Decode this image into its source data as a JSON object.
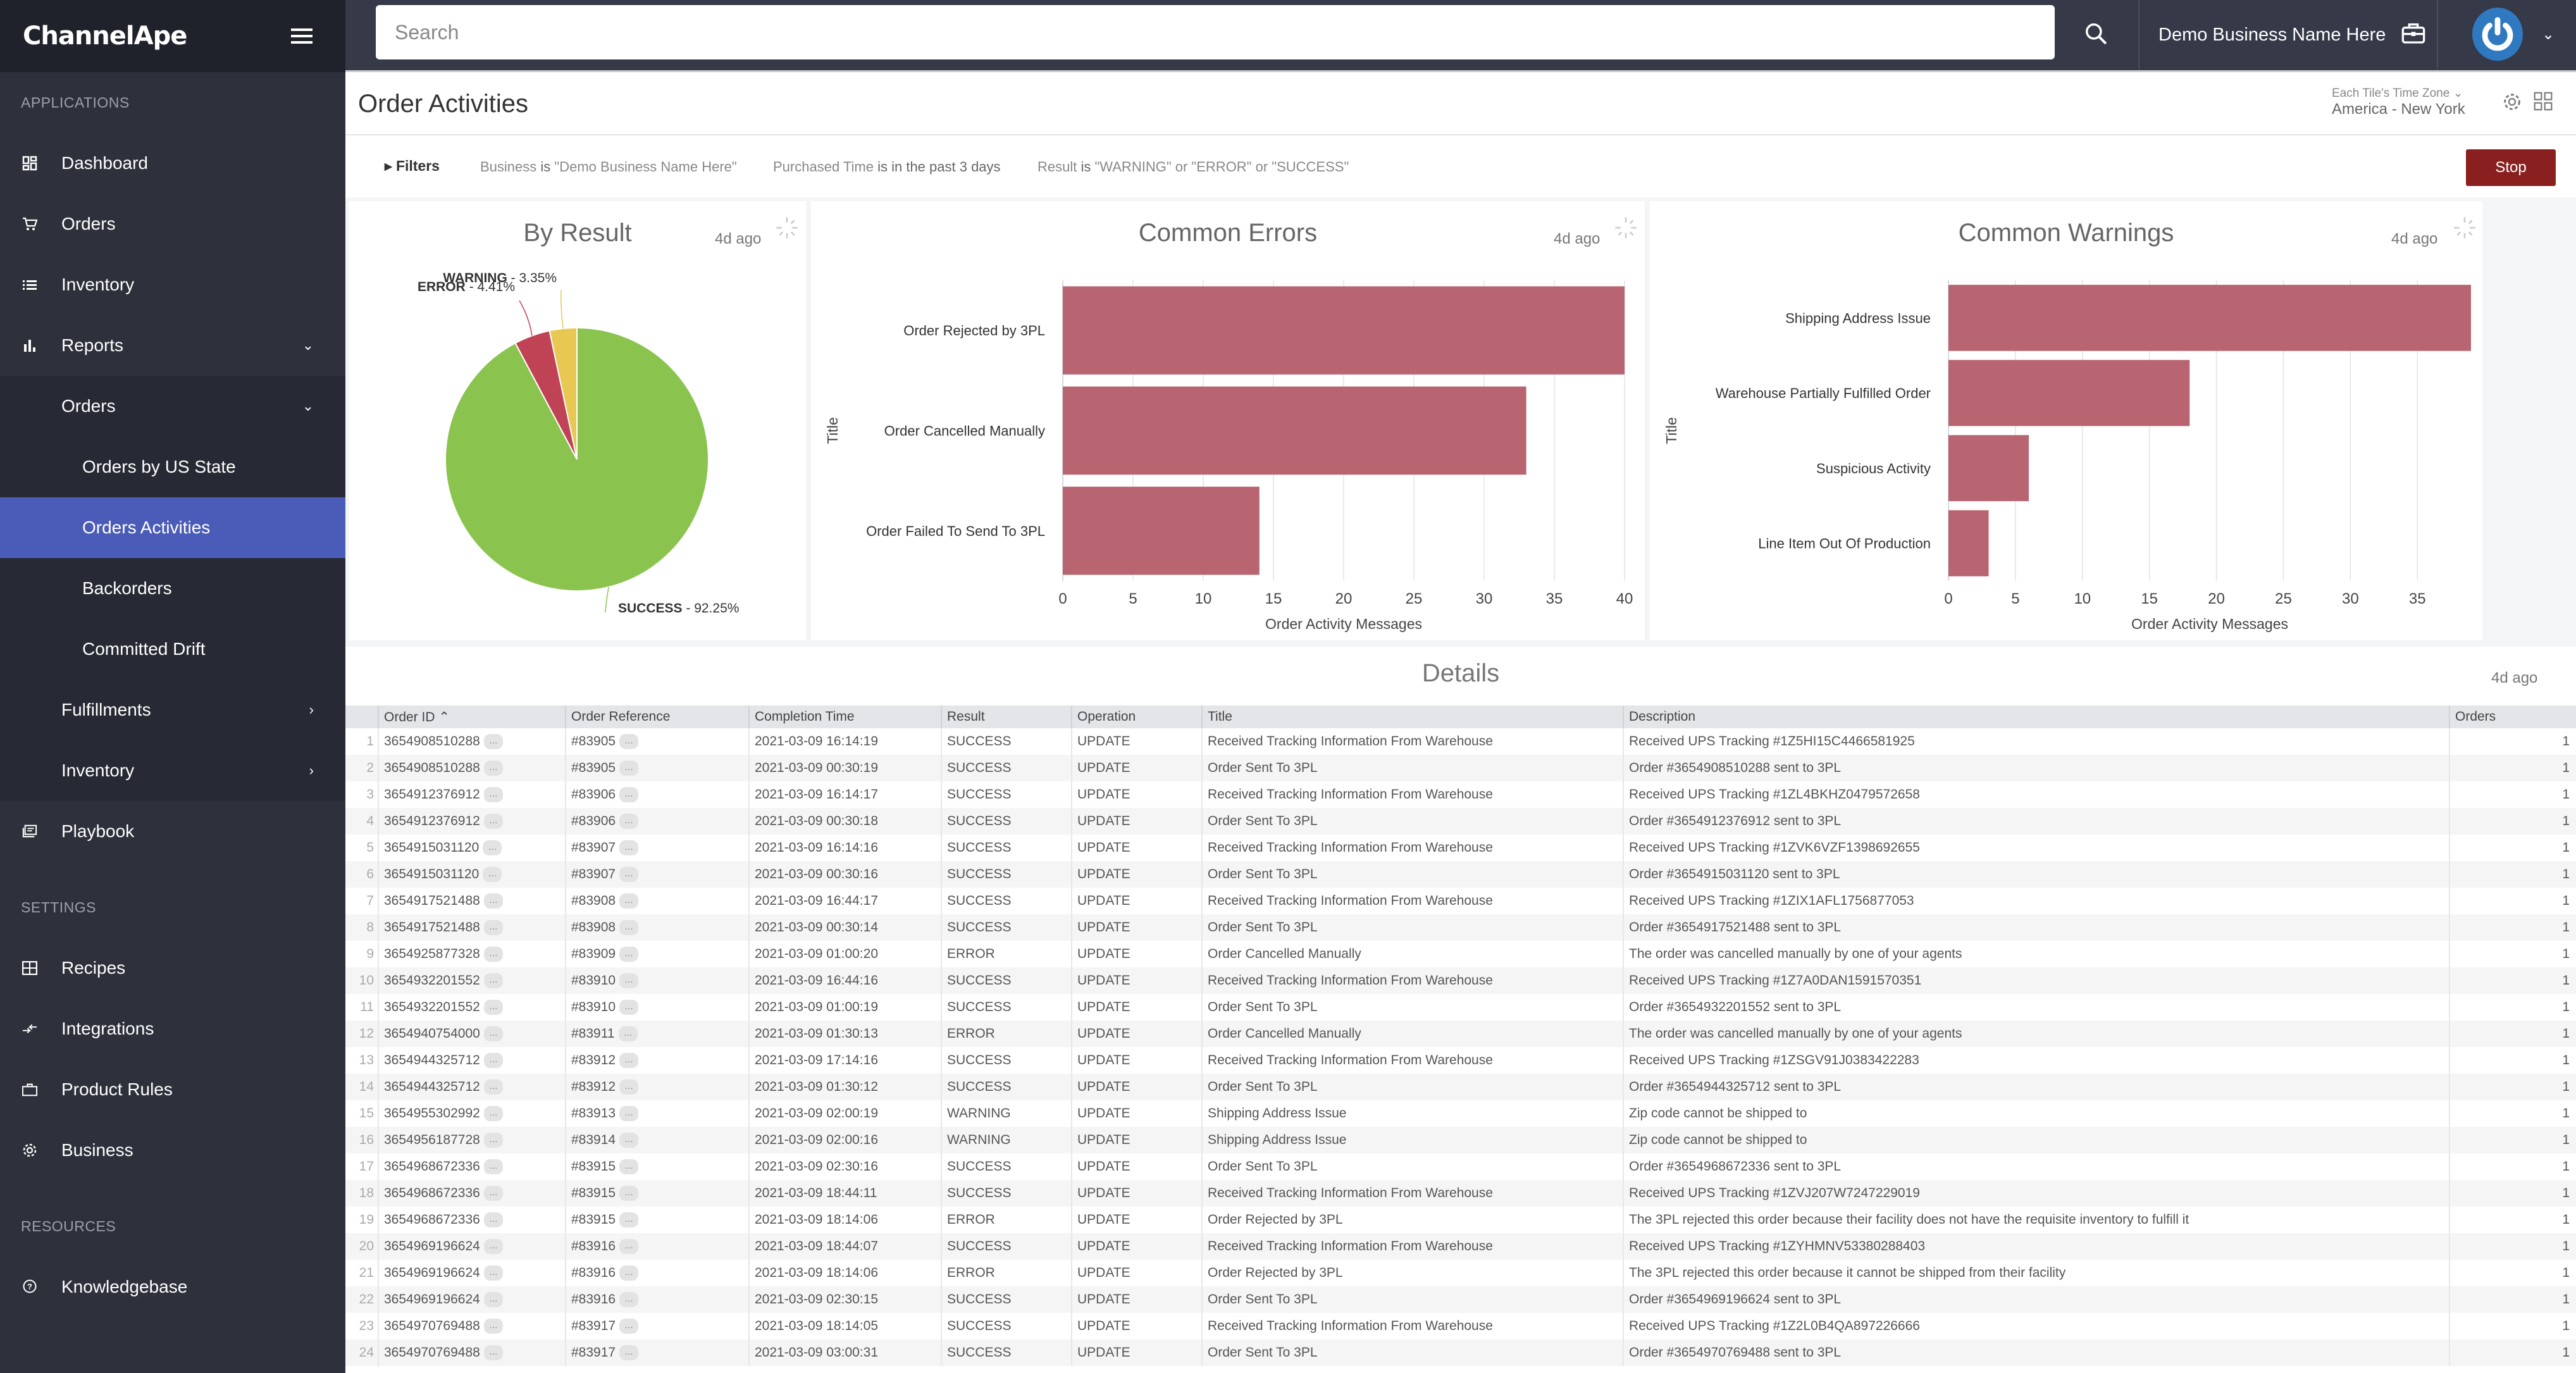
{
  "app": {
    "brand": "ChannelApe"
  },
  "sidebar": {
    "sections": {
      "applications": "APPLICATIONS",
      "settings": "SETTINGS",
      "resources": "RESOURCES"
    },
    "items": {
      "dashboard": "Dashboard",
      "orders": "Orders",
      "inventory": "Inventory",
      "reports": "Reports",
      "reports_orders": "Orders",
      "orders_by_us_state": "Orders by US State",
      "orders_activities": "Orders Activities",
      "backorders": "Backorders",
      "committed_drift": "Committed Drift",
      "fulfillments": "Fulfillments",
      "reports_inventory": "Inventory",
      "playbook": "Playbook",
      "recipes": "Recipes",
      "integrations": "Integrations",
      "product_rules": "Product Rules",
      "business": "Business",
      "knowledgebase": "Knowledgebase"
    },
    "active": "Orders Activities"
  },
  "topbar": {
    "search_placeholder": "Search",
    "business_name": "Demo Business Name Here"
  },
  "page": {
    "title": "Order Activities",
    "timezone_label": "Each Tile's Time Zone",
    "timezone_value": "America - New York"
  },
  "filters": {
    "toggle_label": "Filters",
    "items": [
      {
        "field": "Business",
        "op": "is",
        "value": "\"Demo Business Name Here\""
      },
      {
        "field": "Purchased Time",
        "op": "is in the past 3 days",
        "value": ""
      },
      {
        "field": "Result",
        "op": "is",
        "value": "\"WARNING\" or \"ERROR\" or \"SUCCESS\""
      }
    ],
    "stop_label": "Stop"
  },
  "tiles": {
    "by_result": {
      "title": "By Result",
      "ago": "4d ago"
    },
    "common_errors": {
      "title": "Common Errors",
      "ago": "4d ago"
    },
    "common_warnings": {
      "title": "Common Warnings",
      "ago": "4d ago"
    }
  },
  "chart_data": [
    {
      "type": "pie",
      "title": "By Result",
      "slices": [
        {
          "label": "SUCCESS",
          "value": 92.25,
          "color": "#8bc34f"
        },
        {
          "label": "ERROR",
          "value": 4.41,
          "color": "#c04255"
        },
        {
          "label": "WARNING",
          "value": 3.35,
          "color": "#e8c752"
        }
      ]
    },
    {
      "type": "bar",
      "orientation": "horizontal",
      "title": "Common Errors",
      "categories": [
        "Order Rejected by 3PL",
        "Order Cancelled Manually",
        "Order Failed To Send To 3PL"
      ],
      "values": [
        40,
        33,
        14
      ],
      "xlabel": "Order Activity Messages",
      "ylabel": "Title",
      "xlim": [
        0,
        40
      ],
      "xticks": [
        0,
        5,
        10,
        15,
        20,
        25,
        30,
        35,
        40
      ],
      "color": "#b96571",
      "grid": true
    },
    {
      "type": "bar",
      "orientation": "horizontal",
      "title": "Common Warnings",
      "categories": [
        "Shipping Address Issue",
        "Warehouse Partially Fulfilled Order",
        "Suspicious Activity",
        "Line Item Out Of Production"
      ],
      "values": [
        39,
        18,
        6,
        3
      ],
      "xlabel": "Order Activity Messages",
      "ylabel": "Title",
      "xlim": [
        0,
        39
      ],
      "xticks": [
        0,
        5,
        10,
        15,
        20,
        25,
        30,
        35
      ],
      "color": "#b96571",
      "grid": true
    }
  ],
  "details": {
    "title": "Details",
    "ago": "4d ago",
    "columns": [
      "Order ID",
      "Order Reference",
      "Completion Time",
      "Result",
      "Operation",
      "Title",
      "Description",
      "Orders"
    ],
    "sort_indicator": "^",
    "rows": [
      [
        "3654908510288",
        "#83905",
        "2021-03-09 16:14:19",
        "SUCCESS",
        "UPDATE",
        "Received Tracking Information From Warehouse",
        "Received UPS Tracking #1Z5HI15C4466581925",
        "1"
      ],
      [
        "3654908510288",
        "#83905",
        "2021-03-09 00:30:19",
        "SUCCESS",
        "UPDATE",
        "Order Sent To 3PL",
        "Order #3654908510288 sent to 3PL",
        "1"
      ],
      [
        "3654912376912",
        "#83906",
        "2021-03-09 16:14:17",
        "SUCCESS",
        "UPDATE",
        "Received Tracking Information From Warehouse",
        "Received UPS Tracking #1ZL4BKHZ0479572658",
        "1"
      ],
      [
        "3654912376912",
        "#83906",
        "2021-03-09 00:30:18",
        "SUCCESS",
        "UPDATE",
        "Order Sent To 3PL",
        "Order #3654912376912 sent to 3PL",
        "1"
      ],
      [
        "3654915031120",
        "#83907",
        "2021-03-09 16:14:16",
        "SUCCESS",
        "UPDATE",
        "Received Tracking Information From Warehouse",
        "Received UPS Tracking #1ZVK6VZF1398692655",
        "1"
      ],
      [
        "3654915031120",
        "#83907",
        "2021-03-09 00:30:16",
        "SUCCESS",
        "UPDATE",
        "Order Sent To 3PL",
        "Order #3654915031120 sent to 3PL",
        "1"
      ],
      [
        "3654917521488",
        "#83908",
        "2021-03-09 16:44:17",
        "SUCCESS",
        "UPDATE",
        "Received Tracking Information From Warehouse",
        "Received UPS Tracking #1ZIX1AFL1756877053",
        "1"
      ],
      [
        "3654917521488",
        "#83908",
        "2021-03-09 00:30:14",
        "SUCCESS",
        "UPDATE",
        "Order Sent To 3PL",
        "Order #3654917521488 sent to 3PL",
        "1"
      ],
      [
        "3654925877328",
        "#83909",
        "2021-03-09 01:00:20",
        "ERROR",
        "UPDATE",
        "Order Cancelled Manually",
        "The order was cancelled manually by one of your agents",
        "1"
      ],
      [
        "3654932201552",
        "#83910",
        "2021-03-09 16:44:16",
        "SUCCESS",
        "UPDATE",
        "Received Tracking Information From Warehouse",
        "Received UPS Tracking #1Z7A0DAN1591570351",
        "1"
      ],
      [
        "3654932201552",
        "#83910",
        "2021-03-09 01:00:19",
        "SUCCESS",
        "UPDATE",
        "Order Sent To 3PL",
        "Order #3654932201552 sent to 3PL",
        "1"
      ],
      [
        "3654940754000",
        "#83911",
        "2021-03-09 01:30:13",
        "ERROR",
        "UPDATE",
        "Order Cancelled Manually",
        "The order was cancelled manually by one of your agents",
        "1"
      ],
      [
        "3654944325712",
        "#83912",
        "2021-03-09 17:14:16",
        "SUCCESS",
        "UPDATE",
        "Received Tracking Information From Warehouse",
        "Received UPS Tracking #1ZSGV91J0383422283",
        "1"
      ],
      [
        "3654944325712",
        "#83912",
        "2021-03-09 01:30:12",
        "SUCCESS",
        "UPDATE",
        "Order Sent To 3PL",
        "Order #3654944325712 sent to 3PL",
        "1"
      ],
      [
        "3654955302992",
        "#83913",
        "2021-03-09 02:00:19",
        "WARNING",
        "UPDATE",
        "Shipping Address Issue",
        "Zip code cannot be shipped to",
        "1"
      ],
      [
        "3654956187728",
        "#83914",
        "2021-03-09 02:00:16",
        "WARNING",
        "UPDATE",
        "Shipping Address Issue",
        "Zip code cannot be shipped to",
        "1"
      ],
      [
        "3654968672336",
        "#83915",
        "2021-03-09 02:30:16",
        "SUCCESS",
        "UPDATE",
        "Order Sent To 3PL",
        "Order #3654968672336 sent to 3PL",
        "1"
      ],
      [
        "3654968672336",
        "#83915",
        "2021-03-09 18:44:11",
        "SUCCESS",
        "UPDATE",
        "Received Tracking Information From Warehouse",
        "Received UPS Tracking #1ZVJ207W7247229019",
        "1"
      ],
      [
        "3654968672336",
        "#83915",
        "2021-03-09 18:14:06",
        "ERROR",
        "UPDATE",
        "Order Rejected by 3PL",
        "The 3PL rejected this order because their facility does not have the requisite inventory to fulfill it",
        "1"
      ],
      [
        "3654969196624",
        "#83916",
        "2021-03-09 18:44:07",
        "SUCCESS",
        "UPDATE",
        "Received Tracking Information From Warehouse",
        "Received UPS Tracking #1ZYHMNV53380288403",
        "1"
      ],
      [
        "3654969196624",
        "#83916",
        "2021-03-09 18:14:06",
        "ERROR",
        "UPDATE",
        "Order Rejected by 3PL",
        "The 3PL rejected this order because it cannot be shipped from their facility",
        "1"
      ],
      [
        "3654969196624",
        "#83916",
        "2021-03-09 02:30:15",
        "SUCCESS",
        "UPDATE",
        "Order Sent To 3PL",
        "Order #3654969196624 sent to 3PL",
        "1"
      ],
      [
        "3654970769488",
        "#83917",
        "2021-03-09 18:14:05",
        "SUCCESS",
        "UPDATE",
        "Received Tracking Information From Warehouse",
        "Received UPS Tracking #1Z2L0B4QA897226666",
        "1"
      ],
      [
        "3654970769488",
        "#83917",
        "2021-03-09 03:00:31",
        "SUCCESS",
        "UPDATE",
        "Order Sent To 3PL",
        "Order #3654970769488 sent to 3PL",
        "1"
      ]
    ]
  }
}
